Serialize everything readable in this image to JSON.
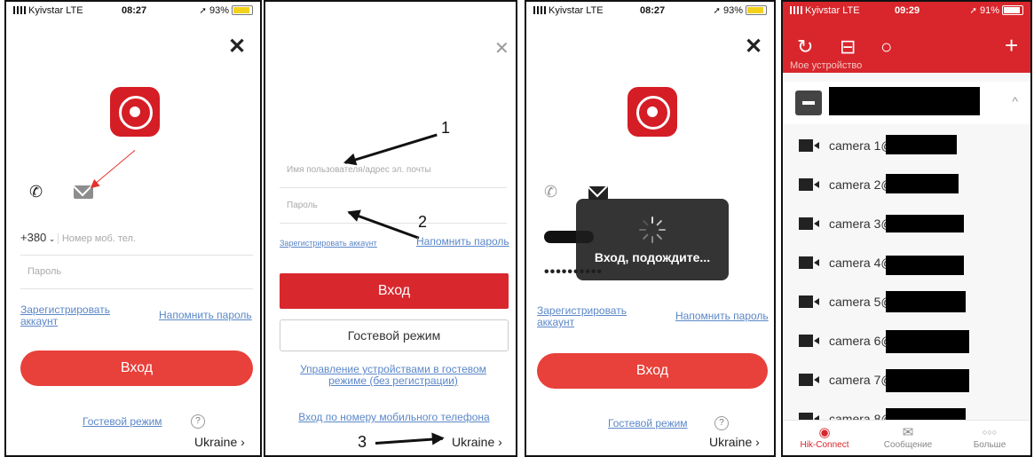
{
  "status_bar": {
    "carrier": "Kyivstar",
    "network": "LTE",
    "time_1": "08:27",
    "time_4": "09:29",
    "battery_1": "93%",
    "battery_4": "91%"
  },
  "login": {
    "close": "✕",
    "phone_code": "+380",
    "phone_placeholder": "Номер моб. тел.",
    "password_placeholder": "Пароль",
    "register_link": "Зарегистрировать аккаунт",
    "forgot_link": "Напомнить пароль",
    "login_button": "Вход",
    "guest_link": "Гостевой режим",
    "help": "?",
    "country": "Ukraine",
    "chevron": "›"
  },
  "email_login": {
    "username_placeholder": "Имя пользователя/адрес эл. почты",
    "password_placeholder": "Пароль",
    "register_link": "Зарегистрировать аккаунт",
    "forgot_link": "Напомнить пароль",
    "login_button": "Вход",
    "guest_button": "Гостевой режим",
    "guest_manage_link": "Управление устройствами в гостевом режиме (без регистрации)",
    "phone_login_link": "Вход по номеру мобильного телефона",
    "country": "Ukraine",
    "annotations": [
      "1",
      "2",
      "3"
    ]
  },
  "loading": {
    "password_dots": "••••••••••",
    "toast_text": "Вход, подождите..."
  },
  "devices": {
    "section_label": "Мое устройство",
    "collapse": "^",
    "cameras": [
      "camera 1@",
      "camera 2@",
      "camera 3@",
      "camera 4@",
      "camera 5@",
      "camera 6@",
      "camera 7@",
      "camera 8@"
    ],
    "tabs": [
      "Hik-Connect",
      "Сообщение",
      "Больше"
    ],
    "tab_icons": [
      "◉",
      "✉",
      "○○○"
    ],
    "toolbar_icons": [
      "refresh-icon",
      "layout-icon",
      "search-icon",
      "add-icon"
    ]
  },
  "colors": {
    "brand_red": "#d8262c",
    "button_red": "#e8403a",
    "link_blue": "#5b87c8"
  }
}
